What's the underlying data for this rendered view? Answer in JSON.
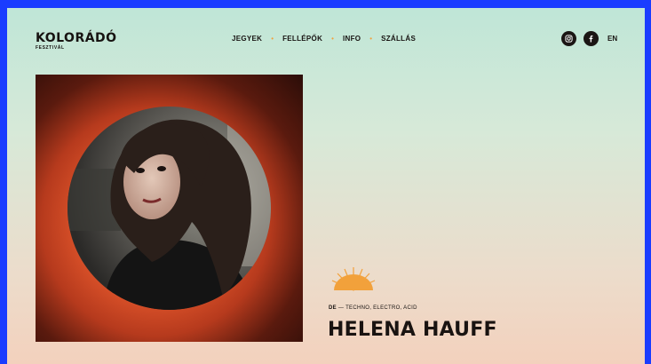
{
  "brand": {
    "name": "KOLORÁDÓ",
    "subtitle": "FESZTIVÁL"
  },
  "nav": {
    "items": [
      "JEGYEK",
      "FELLÉPŐK",
      "INFO",
      "SZÁLLÁS"
    ],
    "separator": "•"
  },
  "social": {
    "icons": [
      "instagram-icon",
      "facebook-icon"
    ],
    "language": "EN"
  },
  "artist": {
    "origin": "DE",
    "genres": "— TECHNO, ELECTRO, ACID",
    "name": "HELENA HAUFF"
  },
  "colors": {
    "accent": "#f2a13b",
    "text": "#171311",
    "border": "#1a3cff",
    "card_orange": "#e95b2e"
  }
}
